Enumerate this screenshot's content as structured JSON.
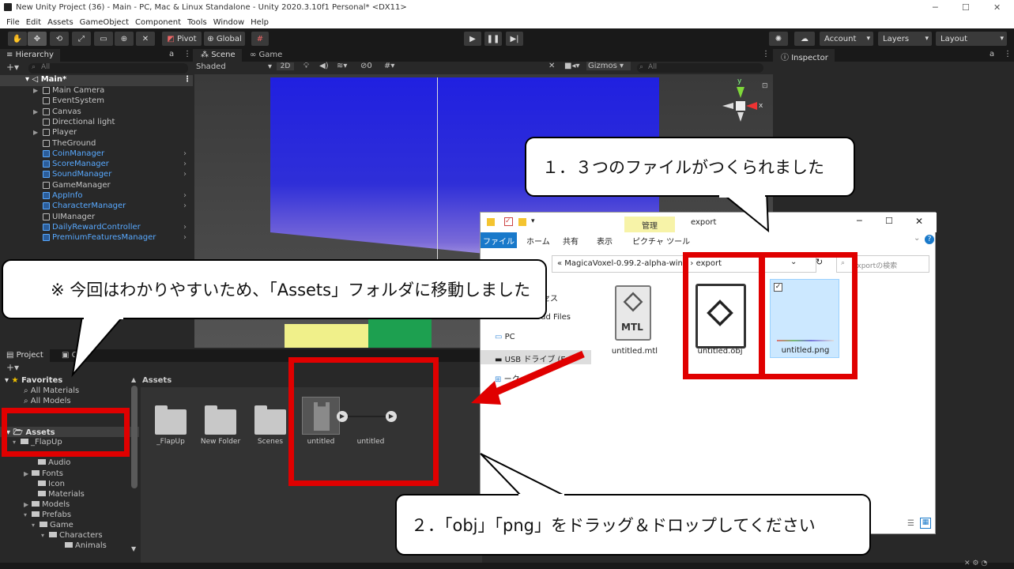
{
  "window": {
    "title": "New Unity Project (36) - Main - PC, Mac & Linux Standalone - Unity 2020.3.10f1 Personal* <DX11>"
  },
  "menu": [
    "File",
    "Edit",
    "Assets",
    "GameObject",
    "Component",
    "Tools",
    "Window",
    "Help"
  ],
  "toolbar": {
    "pivot": "Pivot",
    "global": "Global",
    "account": "Account",
    "layers": "Layers",
    "layout": "Layout"
  },
  "hierarchy": {
    "tab": "Hierarchy",
    "search_placeholder": "All",
    "scene": "Main*",
    "items": [
      {
        "label": "Main Camera",
        "prefab": false,
        "arrow": true
      },
      {
        "label": "EventSystem",
        "prefab": false,
        "arrow": false
      },
      {
        "label": "Canvas",
        "prefab": false,
        "arrow": true
      },
      {
        "label": "Directional light",
        "prefab": false,
        "arrow": false
      },
      {
        "label": "Player",
        "prefab": false,
        "arrow": true
      },
      {
        "label": "TheGround",
        "prefab": false,
        "arrow": false
      },
      {
        "label": "CoinManager",
        "prefab": true,
        "arrow": false
      },
      {
        "label": "ScoreManager",
        "prefab": true,
        "arrow": false
      },
      {
        "label": "SoundManager",
        "prefab": true,
        "arrow": false
      },
      {
        "label": "GameManager",
        "prefab": false,
        "arrow": false
      },
      {
        "label": "AppInfo",
        "prefab": true,
        "arrow": false
      },
      {
        "label": "CharacterManager",
        "prefab": true,
        "arrow": false
      },
      {
        "label": "UIManager",
        "prefab": false,
        "arrow": false
      },
      {
        "label": "DailyRewardController",
        "prefab": true,
        "arrow": false
      },
      {
        "label": "PremiumFeaturesManager",
        "prefab": true,
        "arrow": false
      }
    ]
  },
  "scene": {
    "tab_scene": "Scene",
    "tab_game": "Game",
    "shading": "Shaded",
    "mode_2d": "2D",
    "gizmo_count": "0",
    "gizmos": "Gizmos",
    "search_placeholder": "All",
    "axis_y": "y",
    "axis_x": "x"
  },
  "inspector": {
    "tab": "Inspector"
  },
  "project": {
    "tab_project": "Project",
    "tab_console": "Co",
    "favorites_label": "Favorites",
    "favorites": [
      "All Materials",
      "All Models"
    ],
    "assets_label": "Assets",
    "tree": [
      "_FlapUp",
      "Audio",
      "Fonts",
      "Icon",
      "Materials",
      "Models",
      "Prefabs",
      "Game",
      "Characters",
      "Animals"
    ],
    "breadcrumb": "Assets",
    "files": [
      "_FlapUp",
      "New Folder",
      "Scenes",
      "untitled",
      "untitled"
    ]
  },
  "explorer": {
    "title": "export",
    "ribbon_context": "管理",
    "ribbon_tabs": [
      "ファイル",
      "ホーム",
      "共有",
      "表示",
      "ピクチャ ツール"
    ],
    "path_parent": "MagicaVoxel-0.99.2-alpha-win3",
    "path_current": "export",
    "search_placeholder": "exportの検索",
    "nav": [
      "セス",
      "oud Files",
      "PC",
      "USB ドライブ (E",
      "ーク"
    ],
    "files": [
      "untitled.mtl",
      "untitled.obj",
      "untitled.png"
    ],
    "mtl_label": "MTL"
  },
  "callouts": {
    "c1": "１．３つのファイルがつくられました",
    "c2": "※ 今回はわかりやすいため、「Assets」フォルダに移動しました",
    "c3": "２．「obj」「png」をドラッグ＆ドロップしてください"
  },
  "colors": {
    "annotation_red": "#e00000",
    "prefab_blue": "#58a9ff",
    "sky_blue": "#2f2fd8"
  }
}
